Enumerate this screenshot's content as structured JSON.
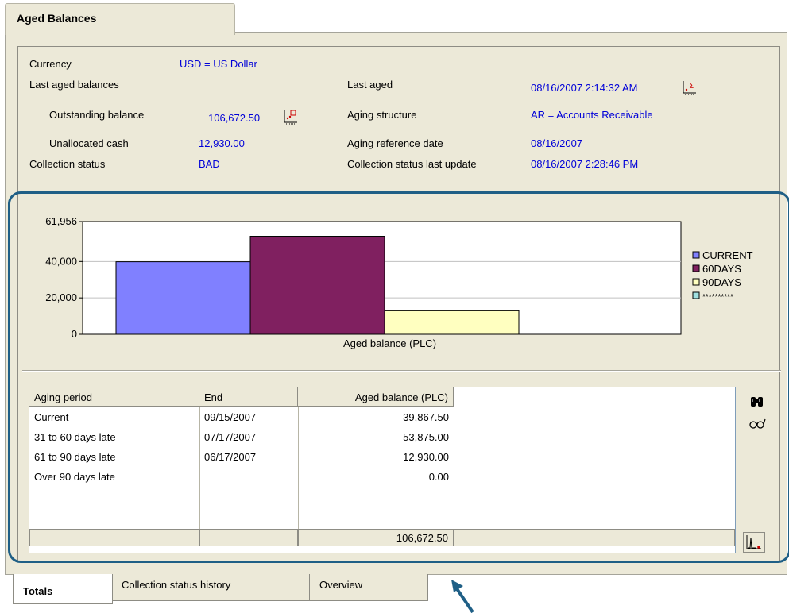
{
  "window": {
    "tab_title": "Aged Balances"
  },
  "fields": {
    "currency_label": "Currency",
    "currency_value": "USD = US Dollar",
    "last_aged_balances_label": "Last aged balances",
    "outstanding_label": "Outstanding balance",
    "outstanding_value": "106,672.50",
    "unallocated_label": "Unallocated cash",
    "unallocated_value": "12,930.00",
    "collection_status_label": "Collection status",
    "collection_status_value": "BAD",
    "last_aged_label": "Last aged",
    "last_aged_value": "08/16/2007 2:14:32 AM",
    "aging_structure_label": "Aging structure",
    "aging_structure_value": "AR = Accounts Receivable",
    "aging_ref_date_label": "Aging reference date",
    "aging_ref_date_value": "08/16/2007",
    "collection_update_label": "Collection status last update",
    "collection_update_value": "08/16/2007 2:28:46 PM"
  },
  "chart_data": {
    "type": "bar",
    "categories": [
      "Aged balance (PLC)"
    ],
    "xlabel": "Aged balance (PLC)",
    "ylim": [
      0,
      61956
    ],
    "y_ticks": [
      "61,956",
      "40,000",
      "20,000",
      "0"
    ],
    "y_tick_values": [
      61956,
      40000,
      20000,
      0
    ],
    "series": [
      {
        "name": "CURRENT",
        "values": [
          39867.5
        ],
        "color": "#8080ff"
      },
      {
        "name": "60DAYS",
        "values": [
          53875.0
        ],
        "color": "#802060"
      },
      {
        "name": "90DAYS",
        "values": [
          12930.0
        ],
        "color": "#ffffc0"
      },
      {
        "name": "**********",
        "values": [
          0
        ],
        "color": "#a0e0e0"
      }
    ],
    "legend_position": "right"
  },
  "grid": {
    "headers": [
      "Aging period",
      "End",
      "Aged balance (PLC)"
    ],
    "rows": [
      {
        "period": "Current",
        "end": "09/15/2007",
        "balance": "39,867.50"
      },
      {
        "period": "31 to 60 days late",
        "end": "07/17/2007",
        "balance": "53,875.00"
      },
      {
        "period": "61 to 90 days late",
        "end": "06/17/2007",
        "balance": "12,930.00"
      },
      {
        "period": "Over 90 days late",
        "end": "",
        "balance": "0.00"
      }
    ],
    "total": "106,672.50"
  },
  "tabs": [
    "Totals",
    "Collection status history",
    "Overview"
  ],
  "icons": {
    "find": "binoculars-icon",
    "view": "glasses-icon",
    "chart_toggle": "chart-icon",
    "aging_detail": "aging-chart-icon"
  },
  "colors": {
    "value_text": "#0000d8",
    "highlight_border": "#1f5f86",
    "panel_bg": "#ece9d8"
  }
}
